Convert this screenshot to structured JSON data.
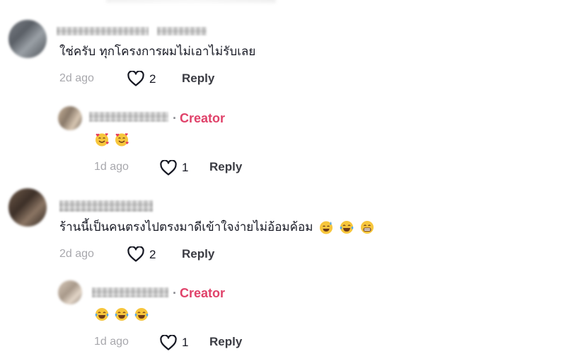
{
  "comments": [
    {
      "text": "ใช่ครับ ทุกโครงการผมไม่เอาไม่รับเลย",
      "time": "2d ago",
      "likes": "2",
      "reply_label": "Reply",
      "reply": {
        "creator_label": "Creator",
        "emojis": [
          "smiling-face-with-hearts-emoji",
          "smiling-face-with-hearts-emoji"
        ],
        "time": "1d ago",
        "likes": "1",
        "reply_label": "Reply"
      }
    },
    {
      "text": "ร้านนี้เป็นคนตรงไปตรงมาดีเข้าใจง่ายไม่อ้อมค้อม",
      "emojis": [
        "sweat-smile-emoji",
        "tears-of-joy-emoji",
        "grinning-emoji"
      ],
      "time": "2d ago",
      "likes": "2",
      "reply_label": "Reply",
      "reply": {
        "creator_label": "Creator",
        "emojis": [
          "tears-of-joy-emoji",
          "tears-of-joy-emoji",
          "tears-of-joy-emoji"
        ],
        "time": "1d ago",
        "likes": "1",
        "reply_label": "Reply"
      }
    }
  ],
  "colors": {
    "creator": "#e0426a",
    "muted": "#a8a8ad",
    "text": "#161823"
  }
}
